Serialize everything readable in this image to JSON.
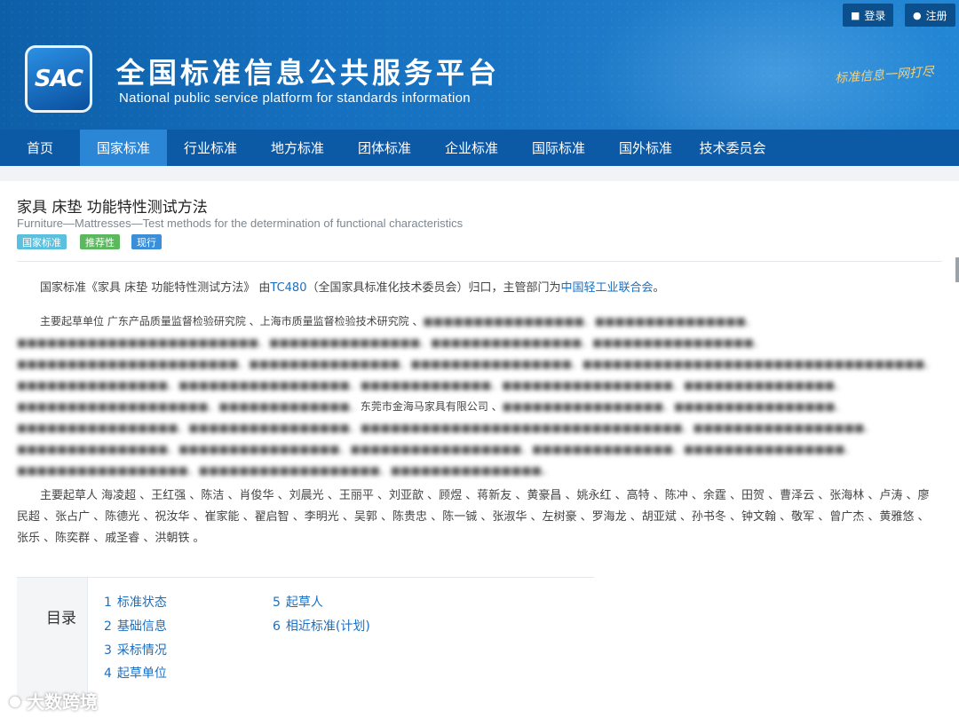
{
  "topbar": {
    "login": {
      "icon": "lock-icon",
      "label": "登录"
    },
    "register": {
      "icon": "user-icon",
      "label": "注册"
    }
  },
  "header": {
    "logo_text": "SAC",
    "title_cn": "全国标准信息公共服务平台",
    "title_en": "National public service platform  for standards information",
    "slogan": "标准信息一网打尽"
  },
  "nav": {
    "items": [
      "首页",
      "国家标准",
      "行业标准",
      "地方标准",
      "团体标准",
      "企业标准",
      "国际标准",
      "国外标准",
      "技术委员会"
    ],
    "active_index": 1
  },
  "standard": {
    "title": "家具 床垫 功能特性测试方法",
    "title_en": "Furniture—Mattresses—Test methods for the determination of functional characteristics",
    "badges": [
      {
        "label": "国家标准",
        "color": "#5bc0de"
      },
      {
        "label": "推荐性",
        "color": "#5cb85c"
      },
      {
        "label": "现行",
        "color": "#3a8fd8"
      }
    ]
  },
  "summary": {
    "prefix": "国家标准《家具 床垫 功能特性测试方法》 由",
    "tc": "TC480",
    "mid": "（全国家具标准化技术委员会）归口，主管部门为",
    "dept": "中国轻工业联合会",
    "suffix": "。"
  },
  "drafting_units": {
    "label": "主要起草单位",
    "visible_1": " 广东产品质量监督检验研究院 、上海市质量监督检验技术研究院 、",
    "visible_2": "东莞市金海马家具有限公司 、"
  },
  "drafters": {
    "label": "主要起草人",
    "names": "海凌超 、王红强 、陈洁 、肖俊华 、刘晨光 、王丽平 、刘亚歆 、顾煜 、蒋新友 、黄豪昌 、姚永红 、高特 、陈冲 、余霆 、田贺 、曹泽云 、张海林 、卢涛 、廖民超 、张占广 、陈德光 、祝汝华 、崔家能 、翟启智 、李明光 、吴郭 、陈贵忠 、陈一铖 、张淑华 、左树豪 、罗海龙 、胡亚斌 、孙书冬 、钟文翰 、敬军 、曾广杰 、黄雅悠 、张乐 、陈奕群 、戚圣睿 、洪朝铁 。"
  },
  "toc": {
    "label": "目录",
    "items": [
      {
        "num": "1",
        "label": "标准状态"
      },
      {
        "num": "2",
        "label": "基础信息"
      },
      {
        "num": "3",
        "label": "采标情况"
      },
      {
        "num": "4",
        "label": "起草单位"
      },
      {
        "num": "5",
        "label": "起草人"
      },
      {
        "num": "6",
        "label": "相近标准(计划)"
      }
    ]
  },
  "watermark": "大数跨境"
}
